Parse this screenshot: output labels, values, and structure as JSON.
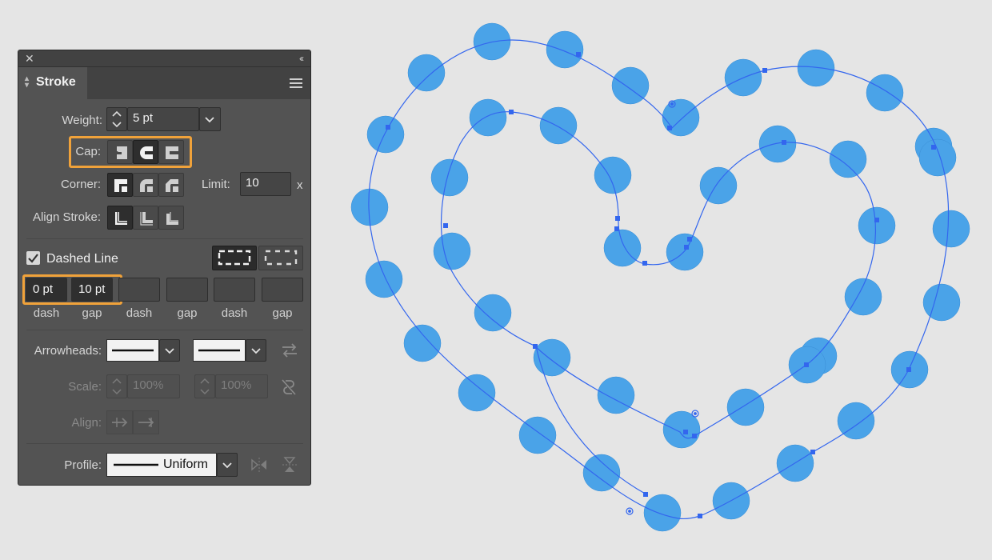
{
  "panel": {
    "tab_title": "Stroke",
    "close_glyph": "✕",
    "collapse_glyph": "‹‹",
    "weight": {
      "label": "Weight:",
      "value": "5 pt"
    },
    "cap": {
      "label": "Cap:",
      "options": [
        "butt-cap",
        "round-cap",
        "projecting-cap"
      ],
      "selected": "round-cap"
    },
    "corner": {
      "label": "Corner:",
      "options": [
        "miter-join",
        "round-join",
        "bevel-join"
      ],
      "selected": "miter-join"
    },
    "limit": {
      "label": "Limit:",
      "value": "10",
      "unit": "x"
    },
    "align_stroke": {
      "label": "Align Stroke:",
      "options": [
        "align-center",
        "align-inside",
        "align-outside"
      ],
      "selected": "align-center"
    },
    "dashed_line": {
      "label": "Dashed Line",
      "checked": true
    },
    "dashes": [
      {
        "value": "0 pt",
        "label": "dash"
      },
      {
        "value": "10 pt",
        "label": "gap"
      },
      {
        "value": "",
        "label": "dash"
      },
      {
        "value": "",
        "label": "gap"
      },
      {
        "value": "",
        "label": "dash"
      },
      {
        "value": "",
        "label": "gap"
      }
    ],
    "arrowheads": {
      "label": "Arrowheads:"
    },
    "scale": {
      "label": "Scale:",
      "start": "100%",
      "end": "100%"
    },
    "align": {
      "label": "Align:"
    },
    "profile": {
      "label": "Profile:",
      "value": "Uniform"
    }
  },
  "colors": {
    "accent_highlight": "#f0a23a",
    "dot_fill": "#4aa3e8",
    "path_stroke": "#3366ee"
  }
}
